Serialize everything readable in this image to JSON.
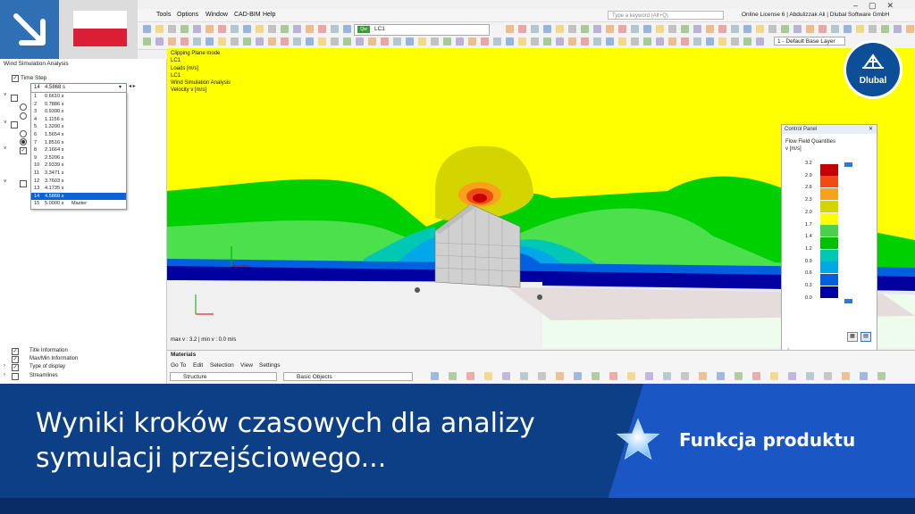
{
  "menubar": {
    "items": [
      "Tools",
      "Options",
      "Window",
      "CAD-BIM",
      "Help"
    ],
    "search_placeholder": "Type a keyword (Alt+Q)",
    "license": "Online License 6 | Abdulizzak Ali | Dlubal Software GmbH"
  },
  "toolbar": {
    "loadcase_badge": "Qw",
    "loadcase": "LC1",
    "layer": "1 - Default Base Layer"
  },
  "navigator": {
    "title": "Wind Simulation Analysis",
    "time_step_label": "Time Step",
    "selected_step": {
      "n": "14",
      "value": "4.5868 s"
    },
    "time_steps": [
      {
        "n": "1",
        "value": "0.6610 s",
        "mark": ""
      },
      {
        "n": "2",
        "value": "0.7886 s",
        "mark": ""
      },
      {
        "n": "3",
        "value": "0.9390 s",
        "mark": ""
      },
      {
        "n": "4",
        "value": "1.1156 s",
        "mark": ""
      },
      {
        "n": "5",
        "value": "1.3200 s",
        "mark": ""
      },
      {
        "n": "6",
        "value": "1.5654 s",
        "mark": ""
      },
      {
        "n": "7",
        "value": "1.8516 s",
        "mark": ""
      },
      {
        "n": "8",
        "value": "2.1664 s",
        "mark": ""
      },
      {
        "n": "9",
        "value": "2.5206 s",
        "mark": ""
      },
      {
        "n": "10",
        "value": "2.9339 s",
        "mark": ""
      },
      {
        "n": "11",
        "value": "3.3471 s",
        "mark": ""
      },
      {
        "n": "12",
        "value": "3.7603 s",
        "mark": ""
      },
      {
        "n": "13",
        "value": "4.1735 s",
        "mark": ""
      },
      {
        "n": "14",
        "value": "4.5868 s",
        "mark": ""
      },
      {
        "n": "15",
        "value": "5.0000 s",
        "mark": "Master"
      }
    ],
    "bottom_items": [
      "Title Information",
      "Max/Min Information",
      "Type of display",
      "Streamlines"
    ]
  },
  "viewport": {
    "info_lines": [
      "Clipping Plane mode",
      "LC1",
      "Loads [m/s]",
      "LC1",
      "Wind Simulation Analysis",
      "Velocity v [m/s]"
    ],
    "maxmin": "max v : 3.2 | min v : 0.0 m/s"
  },
  "control_panel": {
    "title": "Control Panel",
    "heading": "Flow Field Quantities",
    "unit": "v [m/s]",
    "legend": [
      {
        "label": "3.2",
        "color": ""
      },
      {
        "label": "2.9",
        "color": "#c40000"
      },
      {
        "label": "2.6",
        "color": "#f04b12"
      },
      {
        "label": "2.3",
        "color": "#f7a21a"
      },
      {
        "label": "2.0",
        "color": "#d4d400"
      },
      {
        "label": "1.7",
        "color": "#ffff00"
      },
      {
        "label": "1.4",
        "color": "#4cd04c"
      },
      {
        "label": "1.2",
        "color": "#00c000"
      },
      {
        "label": "0.9",
        "color": "#00c8b4"
      },
      {
        "label": "0.6",
        "color": "#00a8e8"
      },
      {
        "label": "0.3",
        "color": "#0060e0"
      },
      {
        "label": "0.0",
        "color": "#0000a0"
      }
    ]
  },
  "logo": {
    "name": "Dlubal"
  },
  "materials": {
    "title": "Materials",
    "menu": [
      "Go To",
      "Edit",
      "Selection",
      "View",
      "Settings"
    ],
    "structure_select": "Structure",
    "objects_select": "Basic Objects"
  },
  "banner": {
    "title": "Wyniki kroków czasowych dla analizy symulacji przejściowego...",
    "feature": "Funkcja produktu"
  },
  "colors": {
    "banner_blue": "#0d3f86",
    "feature_blue": "#1a56c4",
    "accent": "#2f6fb3"
  }
}
